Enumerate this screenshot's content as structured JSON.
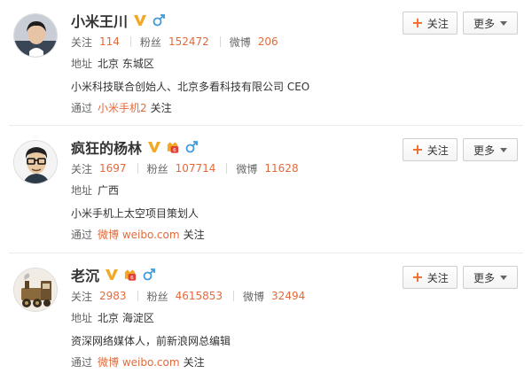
{
  "users": [
    {
      "name": "小米王川",
      "badges": [
        "vip-v-icon",
        "male-icon"
      ],
      "stats": [
        {
          "label": "关注",
          "value": "114"
        },
        {
          "label": "粉丝",
          "value": "152472"
        },
        {
          "label": "微博",
          "value": "206"
        }
      ],
      "location_label": "地址",
      "location": "北京 东城区",
      "bio": "小米科技联合创始人、北京多看科技有限公司 CEO",
      "via_label": "通过",
      "via_source": "小米手机2",
      "via_suffix": "关注",
      "follow_label": "关注",
      "more_label": "更多"
    },
    {
      "name": "疯狂的杨林",
      "badges": [
        "vip-v-icon",
        "level-icon",
        "male-icon"
      ],
      "stats": [
        {
          "label": "关注",
          "value": "1697"
        },
        {
          "label": "粉丝",
          "value": "107714"
        },
        {
          "label": "微博",
          "value": "11628"
        }
      ],
      "location_label": "地址",
      "location": "广西",
      "bio": "小米手机上太空项目策划人",
      "via_label": "通过",
      "via_source": "微博 weibo.com",
      "via_suffix": "关注",
      "follow_label": "关注",
      "more_label": "更多"
    },
    {
      "name": "老沉",
      "badges": [
        "vip-v-icon",
        "level-icon",
        "male-icon"
      ],
      "stats": [
        {
          "label": "关注",
          "value": "2983"
        },
        {
          "label": "粉丝",
          "value": "4615853"
        },
        {
          "label": "微博",
          "value": "32494"
        }
      ],
      "location_label": "地址",
      "location": "北京 海淀区",
      "bio": "资深网络媒体人，前新浪网总编辑",
      "via_label": "通过",
      "via_source": "微博 weibo.com",
      "via_suffix": "关注",
      "follow_label": "关注",
      "more_label": "更多"
    }
  ],
  "colors": {
    "accent": "#e36a3b",
    "vip": "#f5a623",
    "male": "#3f9bd9",
    "plus": "#f06b2b"
  }
}
